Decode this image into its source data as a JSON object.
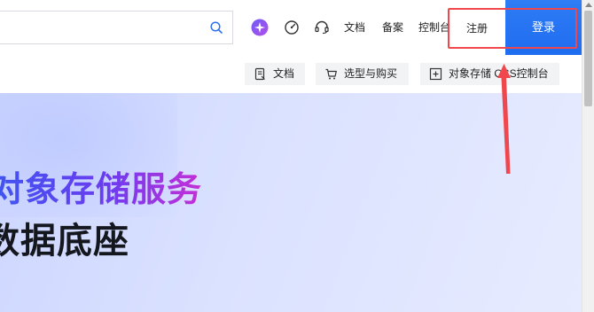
{
  "header": {
    "search_placeholder": "",
    "nav": {
      "docs": "文档",
      "filing": "备案",
      "console": "控制台"
    },
    "register": "注册",
    "login": "登录"
  },
  "subnav": {
    "docs": "文档",
    "select_buy": "选型与购买",
    "oss_console": "对象存储 OSS控制台"
  },
  "hero": {
    "title_line1": "对象存储服务",
    "title_line2": "数据底座"
  },
  "colors": {
    "login_bg": "#1f6df0",
    "highlight": "#f0474f",
    "hero_gradient_start": "#3d56f0",
    "hero_gradient_end": "#c62fd6"
  }
}
